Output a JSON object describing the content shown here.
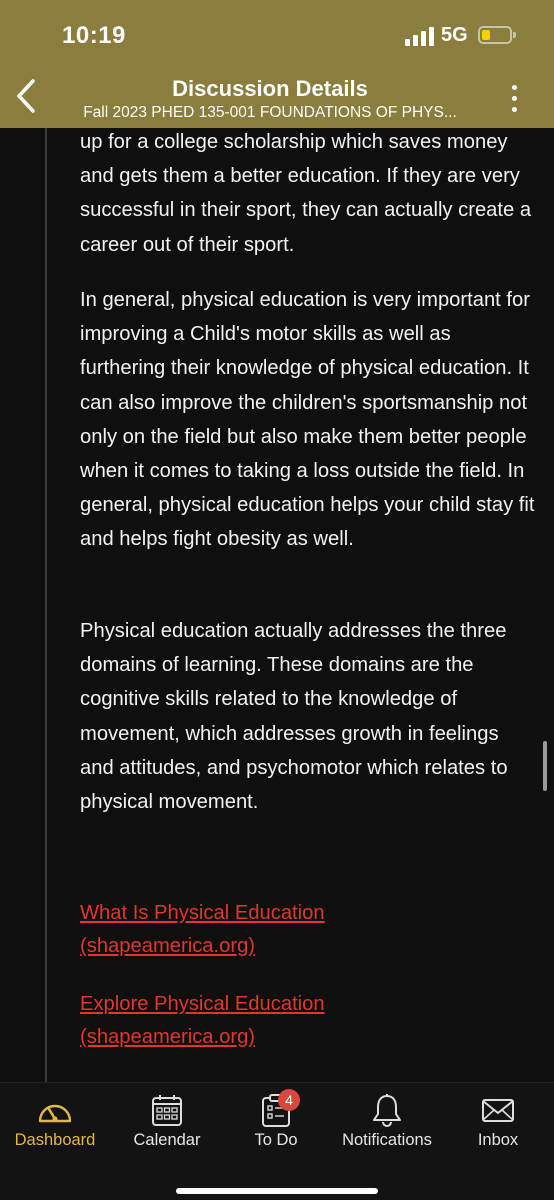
{
  "status": {
    "time": "10:19",
    "network": "5G"
  },
  "header": {
    "title": "Discussion Details",
    "subtitle": "Fall 2023 PHED 135-001 FOUNDATIONS OF PHYS..."
  },
  "content": {
    "paragraphs": [
      "up for a college scholarship which saves money and gets them a better education. If they are very successful in their sport, they can actually create a career out of their sport.",
      "In general, physical education is very important for improving a Child's motor skills as well as furthering their knowledge of physical education. It can also improve the children's sportsmanship not only on the field but also make them better people when it comes to taking a loss outside the field. In general, physical education helps your child stay fit and helps fight obesity as well.",
      "Physical education actually addresses the three domains of learning. These domains are the cognitive skills related to the knowledge of movement, which addresses growth in feelings and attitudes, and psychomotor which relates to physical movement."
    ],
    "links": [
      "What Is Physical Education (shapeamerica.org)",
      "Explore Physical Education (shapeamerica.org)"
    ]
  },
  "tabbar": {
    "tabs": [
      {
        "label": "Dashboard",
        "icon": "dashboard-gauge-icon",
        "active": true
      },
      {
        "label": "Calendar",
        "icon": "calendar-icon"
      },
      {
        "label": "To Do",
        "icon": "todo-clipboard-icon",
        "badge": "4"
      },
      {
        "label": "Notifications",
        "icon": "bell-icon"
      },
      {
        "label": "Inbox",
        "icon": "envelope-icon"
      }
    ]
  },
  "colors": {
    "header": "#8a7d3d",
    "accent": "#e0b84a",
    "link": "#e0362b",
    "badge": "#d9493b",
    "background": "#0f0f10"
  }
}
